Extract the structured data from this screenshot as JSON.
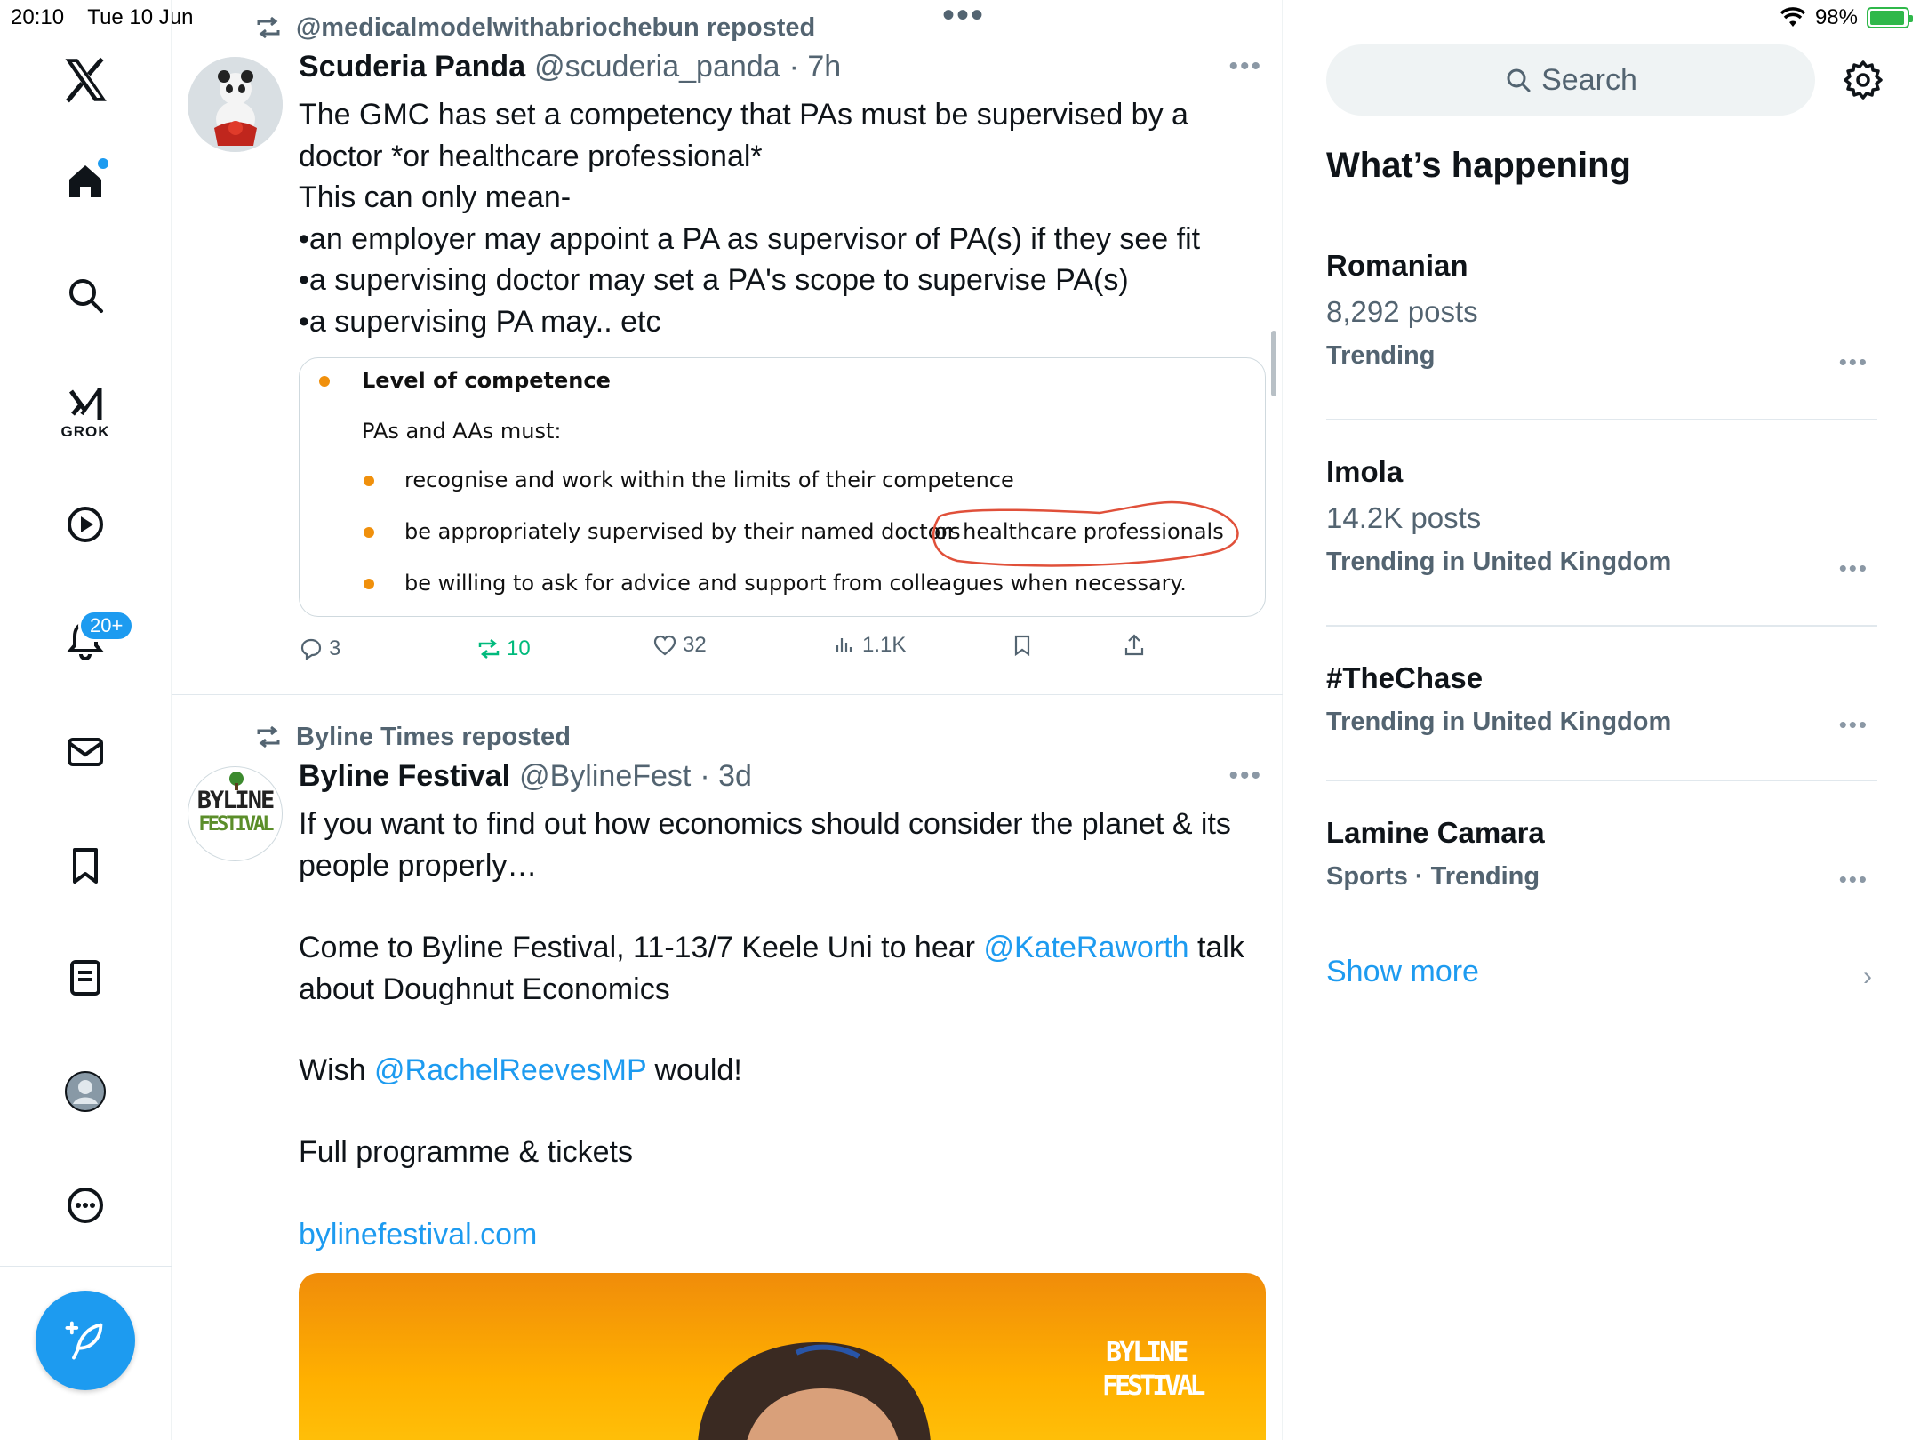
{
  "status": {
    "time": "20:10",
    "date": "Tue 10 Jun",
    "battery": "98%"
  },
  "nav": {
    "notifications_badge": "20+",
    "grok_label": "GROK"
  },
  "tweets": [
    {
      "repost_by": "@medicalmodelwithabriochebun reposted",
      "name": "Scuderia Panda",
      "handle": "@scuderia_panda",
      "time": "· 7h",
      "text": "The GMC has set a competency that PAs must be supervised by a\ndoctor *or healthcare professional*\nThis can only mean-\n•an employer may appoint a PA as supervisor of PA(s) if they see fit\n•a supervising doctor may set a PA's scope to supervise PA(s)\n•a supervising PA may.. etc",
      "doc": {
        "heading": "Level of competence",
        "intro": "PAs and AAs must:",
        "bullets": [
          "recognise and work within the limits of their competence",
          "be appropriately supervised by their named doctors",
          "be willing to ask for advice and support from colleagues when necessary."
        ],
        "circled": "or healthcare professionals"
      },
      "stats": {
        "replies": "3",
        "reposts": "10",
        "likes": "32",
        "views": "1.1K"
      }
    },
    {
      "repost_by": "Byline Times reposted",
      "name": "Byline Festival",
      "handle": "@BylineFest",
      "time": "· 3d",
      "avatar_text_1": "BYLINE",
      "avatar_text_2": "FESTIVAL",
      "text_1": "If you want to find out how economics should consider the planet & its\npeople properly…",
      "text_2a": "Come to Byline Festival, 11-13/7 Keele Uni  to hear ",
      "mention_1": "@KateRaworth",
      "text_2b": " talk\nabout Doughnut Economics",
      "text_3a": "Wish ",
      "mention_2": "@RachelReevesMP",
      "text_3b": " would!",
      "text_4": "Full programme & tickets",
      "url": "bylinefestival.com",
      "image_logo_1": "BYLINE",
      "image_logo_2": "FESTIVAL"
    }
  ],
  "right": {
    "search_placeholder": "Search",
    "section_title": "What’s happening",
    "trends": [
      {
        "name": "Romanian",
        "count": "8,292 posts",
        "context": "Trending"
      },
      {
        "name": "Imola",
        "count": "14.2K posts",
        "context": "Trending in United Kingdom"
      },
      {
        "name": "#TheChase",
        "count": "",
        "context": "Trending in United Kingdom"
      },
      {
        "name": "Lamine Camara",
        "count": "",
        "context": "Sports · Trending"
      }
    ],
    "show_more": "Show more"
  },
  "colors": {
    "accent": "#1d9bf0",
    "repost_green": "#00ba7c",
    "muted": "#536471"
  }
}
